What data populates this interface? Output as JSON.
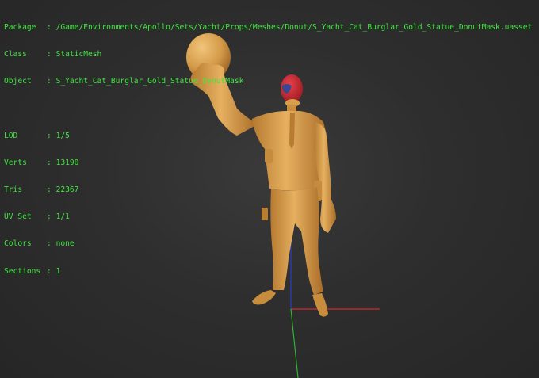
{
  "info": {
    "package_label": "Package",
    "package_value": "/Game/Environments/Apollo/Sets/Yacht/Props/Meshes/Donut/S_Yacht_Cat_Burglar_Gold_Statue_DonutMask.uasset",
    "class_label": "Class",
    "class_value": "StaticMesh",
    "object_label": "Object",
    "object_value": "S_Yacht_Cat_Burglar_Gold_Statue_DonutMask",
    "lod_label": "LOD",
    "lod_value": "1/5",
    "verts_label": "Verts",
    "verts_value": "13190",
    "tris_label": "Tris",
    "tris_value": "22367",
    "uvset_label": "UV Set",
    "uvset_value": "1/1",
    "colors_label": "Colors",
    "colors_value": "none",
    "sections_label": "Sections",
    "sections_value": "1"
  },
  "colors": {
    "text": "#3fe63f",
    "statue": "#d9a04c",
    "mask": "#c8252f",
    "axis_x": "#d42a2a",
    "axis_y": "#2fb52f",
    "axis_z": "#2a3cc8"
  }
}
